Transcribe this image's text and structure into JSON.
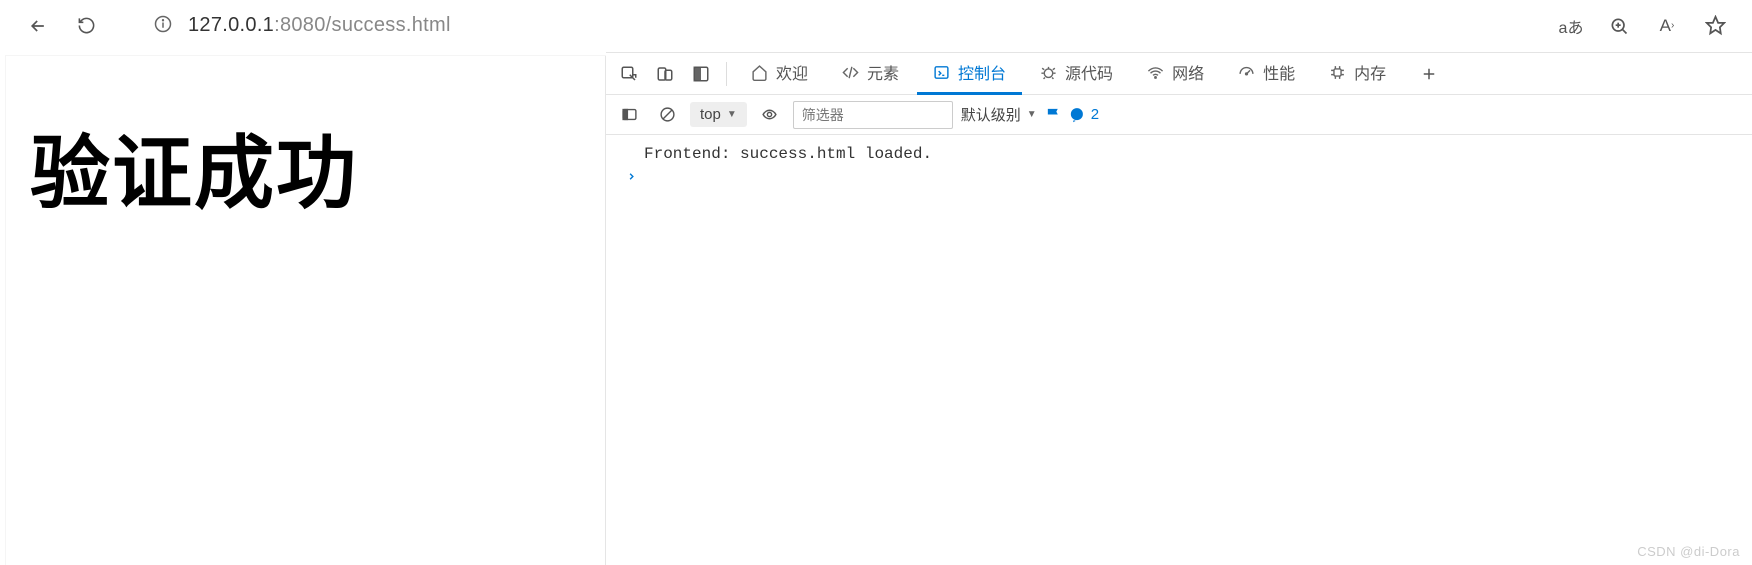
{
  "browser": {
    "url_host": "127.0.0.1",
    "url_port": ":8080",
    "url_path": "/success.html",
    "right_glyph_aa": "aあ",
    "right_glyph_font": "A"
  },
  "page": {
    "heading": "验证成功"
  },
  "devtools": {
    "tabs": {
      "welcome": "欢迎",
      "elements": "元素",
      "console": "控制台",
      "sources": "源代码",
      "network": "网络",
      "performance": "性能",
      "memory": "内存"
    },
    "console_toolbar": {
      "context": "top",
      "filter_placeholder": "筛选器",
      "level": "默认级别",
      "issues_count": "2"
    },
    "console": {
      "line1": "Frontend: success.html loaded.",
      "prompt": ">"
    }
  },
  "watermark": "CSDN @di-Dora"
}
